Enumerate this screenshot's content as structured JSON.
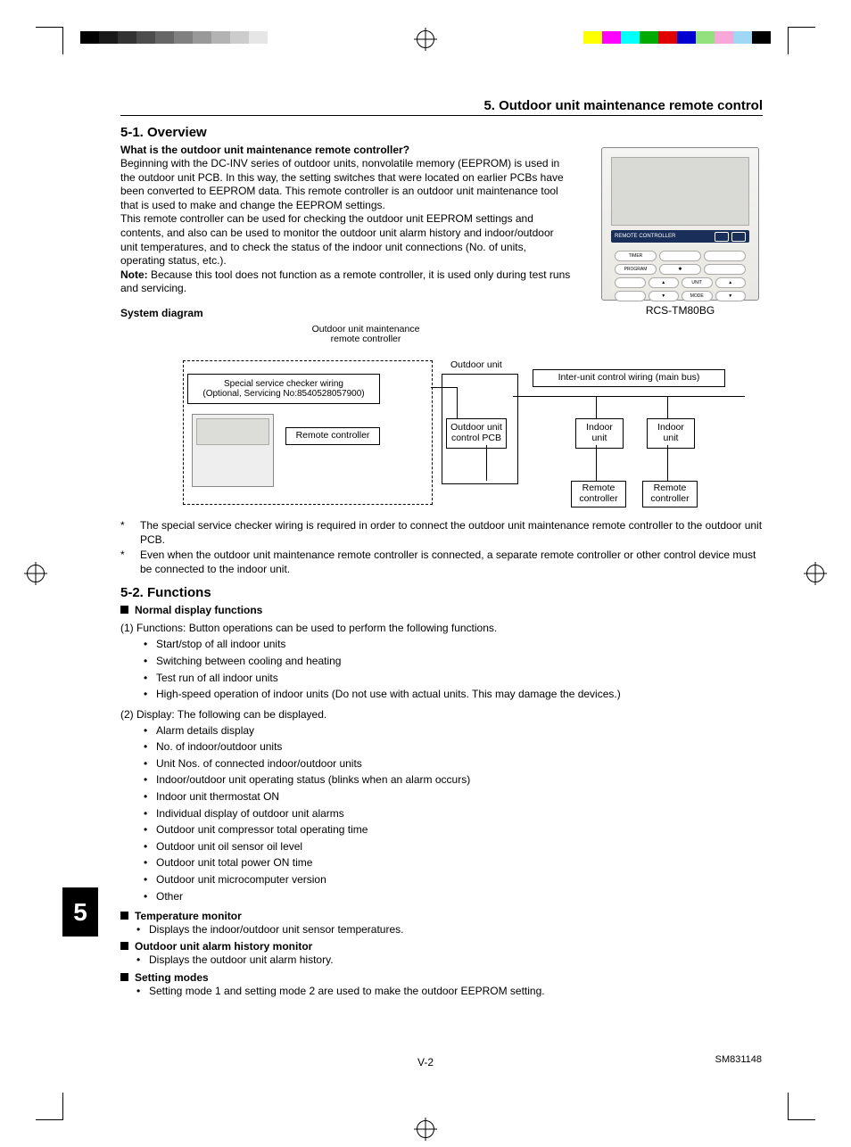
{
  "header": {
    "section_title": "5. Outdoor unit maintenance remote control"
  },
  "overview": {
    "h": "5-1. Overview",
    "q": "What is the outdoor unit maintenance remote controller?",
    "p1": "Beginning with the DC-INV series of outdoor units, nonvolatile memory (EEPROM) is used in the outdoor unit PCB. In this way, the setting switches that were located on earlier PCBs have been converted to EEPROM data. This remote controller is an outdoor unit maintenance tool that is used to make and change the EEPROM settings.",
    "p2": "This remote controller can be used for checking the outdoor unit EEPROM settings and contents, and also can be used to monitor the outdoor unit alarm history and indoor/outdoor unit temperatures, and to check the status of the indoor unit connections (No. of units, operating status, etc.).",
    "note_label": "Note:",
    "note_text": " Because this tool does not function as a remote controller, it is used only during test runs and servicing.",
    "sysdiag_h": "System diagram",
    "model": "RCS-TM80BG"
  },
  "diagram": {
    "maint_rc": "Outdoor unit maintenance\nremote controller",
    "svc_wiring": "Special service checker wiring\n(Optional, Servicing No:8540528057900)",
    "rc": "Remote controller",
    "ou": "Outdoor unit",
    "ou_pcb": "Outdoor unit\ncontrol PCB",
    "interunit": "Inter-unit control wiring (main bus)",
    "iu": "Indoor\nunit",
    "rc2": "Remote\ncontroller"
  },
  "notes": {
    "n1": "The special service checker wiring is required in order to connect the outdoor unit maintenance remote controller to the outdoor unit PCB.",
    "n2": "Even when the outdoor unit maintenance remote controller is connected, a separate remote controller or other control device must be connected to the indoor unit."
  },
  "functions": {
    "h": "5-2. Functions",
    "normal_h": "Normal display functions",
    "f1_intro": "(1) Functions: Button operations can be used to perform the following functions.",
    "f1_items": [
      "Start/stop of all indoor units",
      "Switching between cooling and heating",
      "Test run of all indoor units",
      "High-speed operation of indoor units (Do not use with actual units. This may damage the devices.)"
    ],
    "f2_intro": "(2) Display: The following can be displayed.",
    "f2_items": [
      "Alarm details display",
      "No. of indoor/outdoor units",
      "Unit Nos. of connected indoor/outdoor units",
      "Indoor/outdoor unit operating status (blinks when an alarm occurs)",
      "Indoor unit thermostat ON",
      "Individual display of outdoor unit alarms",
      "Outdoor unit compressor total operating time",
      "Outdoor unit oil sensor oil level",
      "Outdoor unit total power ON time",
      "Outdoor unit microcomputer version",
      "Other"
    ],
    "temp_h": "Temperature monitor",
    "temp_item": "Displays the indoor/outdoor unit sensor temperatures.",
    "alarm_h": "Outdoor unit alarm history monitor",
    "alarm_item": "Displays the outdoor unit alarm history.",
    "setting_h": "Setting modes",
    "setting_item": "Setting mode 1 and setting mode 2 are used to make the outdoor EEPROM setting."
  },
  "remote_strip_label": "REMOTE CONTROLLER",
  "remote_btn_labels": {
    "timer": "TIMER",
    "program": "PROGRAM",
    "unit": "UNIT",
    "mode": "MODE"
  },
  "chapter_tab": "5",
  "footer": "V-2",
  "doc_id": "SM831148"
}
